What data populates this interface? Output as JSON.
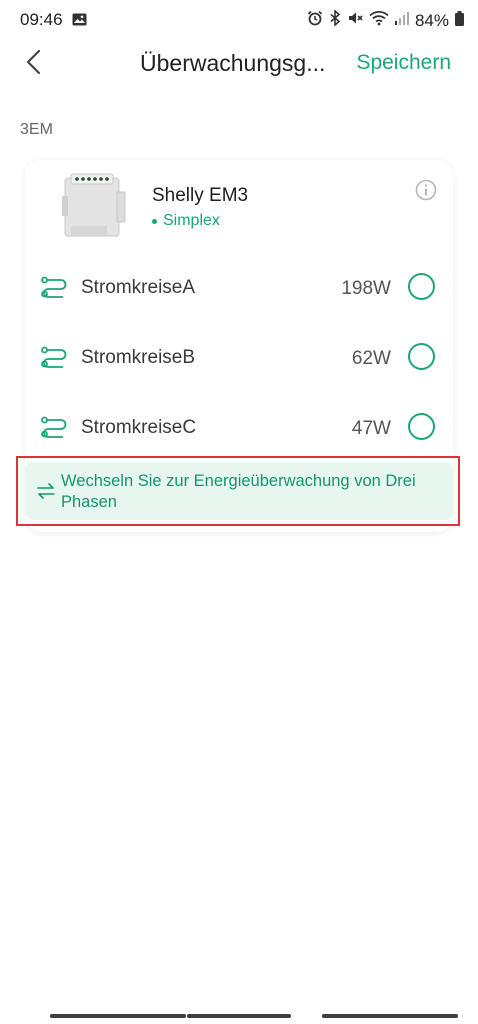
{
  "status_bar": {
    "time": "09:46",
    "battery": "84%",
    "icons": [
      "photo-icon",
      "alarm-icon",
      "bluetooth-icon",
      "mute-icon",
      "wifi-icon",
      "signal-icon",
      "battery-icon"
    ]
  },
  "header": {
    "back_icon": "chevron-left-icon",
    "title": "Überwachungsg...",
    "save_label": "Speichern"
  },
  "section": {
    "label": "3EM"
  },
  "device": {
    "name": "Shelly EM3",
    "status": "Simplex",
    "info_icon": "info-icon"
  },
  "circuits": [
    {
      "label": "StromkreiseA",
      "power": "198W"
    },
    {
      "label": "StromkreiseB",
      "power": "62W"
    },
    {
      "label": "StromkreiseC",
      "power": "47W"
    }
  ],
  "switch_banner": {
    "text": "Wechseln Sie zur Energieüberwachung von Drei Phasen",
    "icon": "swap-arrows-icon"
  },
  "colors": {
    "accent": "#1aa57a",
    "banner_bg": "#e8f6f0",
    "highlight": "#d9343f"
  }
}
